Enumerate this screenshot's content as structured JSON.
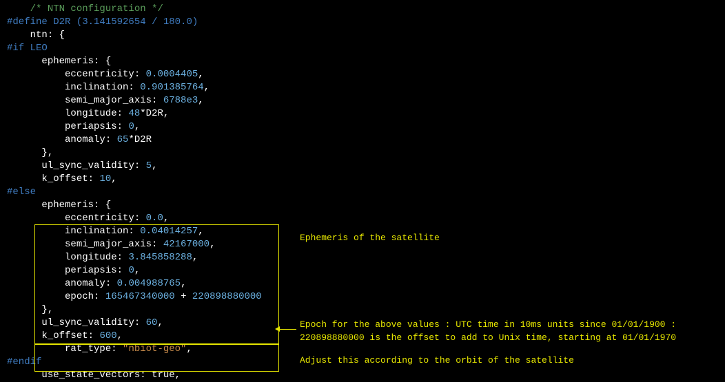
{
  "code": {
    "comment_ntn": "/* NTN configuration */",
    "define": "#define D2R (3.141592654 / 180.0)",
    "ntn_open": "ntn: {",
    "if_leo": "#if LEO",
    "eph_open": "ephemeris: {",
    "leo": {
      "eccentricity_k": "eccentricity:",
      "eccentricity_v": "0.0004405",
      "inclination_k": "inclination:",
      "inclination_v": "0.901385764",
      "semi_k": "semi_major_axis:",
      "semi_v": "6788e3",
      "longitude_k": "longitude:",
      "longitude_v": "48",
      "longitude_op": "*D2R",
      "periapsis_k": "periapsis:",
      "periapsis_v": "0",
      "anomaly_k": "anomaly:",
      "anomaly_v": "65",
      "anomaly_op": "*D2R"
    },
    "brace_close": "},",
    "ul_sync_k": "ul_sync_validity:",
    "leo_ul_sync_v": "5",
    "k_offset_k": "k_offset:",
    "leo_k_offset_v": "10",
    "else": "#else",
    "geo": {
      "eccentricity_v": "0.0",
      "inclination_v": "0.04014257",
      "semi_v": "42167000",
      "longitude_v": "3.845858288",
      "periapsis_v": "0",
      "anomaly_v": "0.004988765",
      "epoch_k": "epoch:",
      "epoch_v1": "165467340000",
      "epoch_plus": " + ",
      "epoch_v2": "220898880000"
    },
    "geo_ul_sync_v": "60",
    "geo_k_offset_v": "600",
    "rat_type_k": "rat_type:",
    "rat_type_v": "\"nbiot-geo\"",
    "endif": "#endif",
    "use_state_k": "use_state_vectors:",
    "use_state_v": "true",
    "comma": ","
  },
  "annot": {
    "ephemeris": "Ephemeris of the satellite",
    "epoch_l1": "Epoch for the above values : UTC time in 10ms units since 01/01/1900 :",
    "epoch_l2": "220898880000 is the offset to add to Unix time, starting at 01/01/1970",
    "adjust": "Adjust this according to the orbit of the satellite"
  }
}
